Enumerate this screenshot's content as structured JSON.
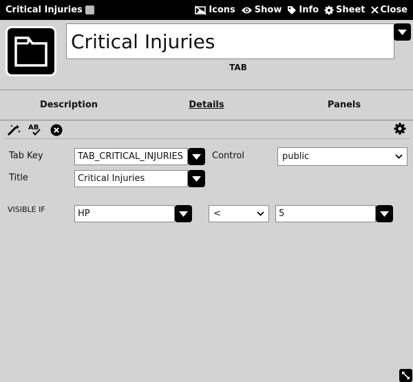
{
  "window": {
    "title": "Critical Injuries",
    "actions": {
      "icons": "Icons",
      "show": "Show",
      "info": "Info",
      "sheet": "Sheet",
      "close": "Close"
    }
  },
  "header": {
    "name_value": "Critical Injuries",
    "type_label": "TAB"
  },
  "tabs": [
    {
      "label": "Description",
      "active": false
    },
    {
      "label": "Details",
      "active": true
    },
    {
      "label": "Panels",
      "active": false
    }
  ],
  "form": {
    "tab_key_label": "Tab Key",
    "tab_key_value": "TAB_CRITICAL_INJURIES",
    "control_label": "Control",
    "control_value": "public",
    "title_label": "Title",
    "title_value": "Critical Injuries",
    "visible_if_label": "VISIBLE IF",
    "visible_if_field": "HP",
    "visible_if_operator": "<",
    "visible_if_value": "5"
  },
  "icons": [
    "book-icon",
    "no-image-icon",
    "eye-icon",
    "tag-icon",
    "gear-icon",
    "close-icon",
    "tab-tile-icon",
    "magic-wand-icon",
    "spellcheck-icon",
    "clear-icon",
    "settings-gear-icon",
    "resize-icon"
  ],
  "colors": {
    "background": "#d3d3d3",
    "titlebar": "#000000",
    "accent": "#000000"
  }
}
